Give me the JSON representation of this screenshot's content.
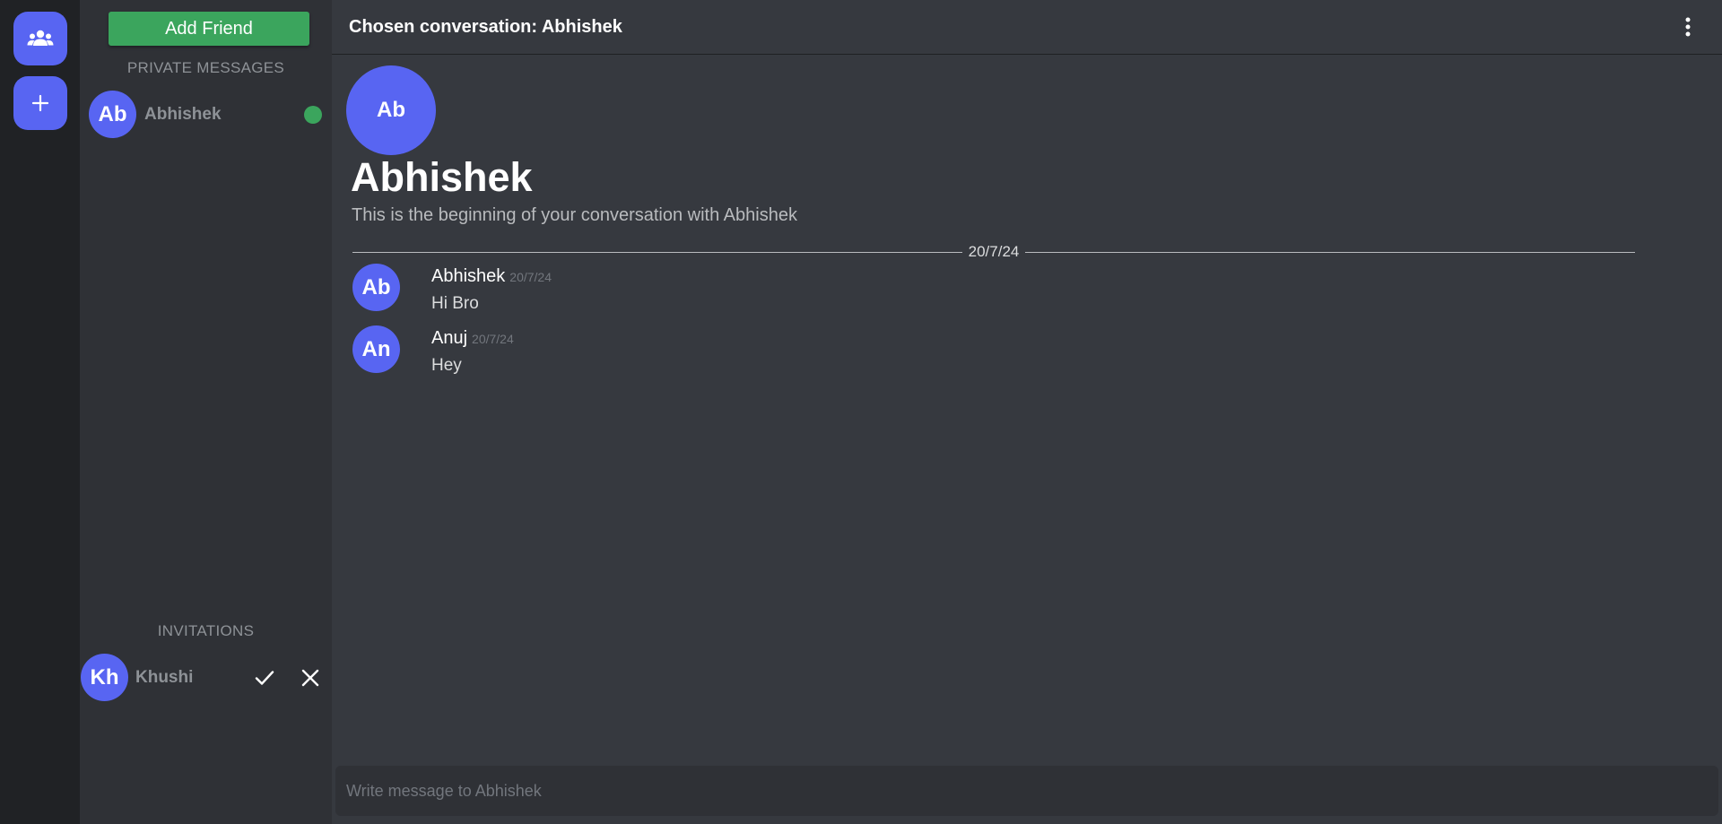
{
  "rail": {
    "friends_icon": "people-icon",
    "add_icon": "plus-icon",
    "accent": "#5865f2"
  },
  "sidebar": {
    "add_friend_label": "Add Friend",
    "private_messages_title": "PRIVATE MESSAGES",
    "private_messages": [
      {
        "initials": "Ab",
        "name": "Abhishek",
        "online": true
      }
    ],
    "invitations_title": "INVITATIONS",
    "invitations": [
      {
        "initials": "Kh",
        "name": "Khushi",
        "accept_icon": "check-icon",
        "reject_icon": "close-icon"
      }
    ]
  },
  "header": {
    "title": "Chosen conversation: Abhishek",
    "menu_icon": "kebab-menu-icon"
  },
  "conversation": {
    "intro_initials": "Ab",
    "intro_name": "Abhishek",
    "intro_text": "This is the beginning of your conversation with Abhishek",
    "date_divider": "20/7/24",
    "messages": [
      {
        "initials": "Ab",
        "author": "Abhishek",
        "time": "20/7/24",
        "text": "Hi Bro"
      },
      {
        "initials": "An",
        "author": "Anuj",
        "time": "20/7/24",
        "text": "Hey"
      }
    ]
  },
  "composer": {
    "placeholder": "Write message to Abhishek"
  },
  "colors": {
    "online": "#3ba55d",
    "add_friend": "#3ba55d",
    "background": "#36393f",
    "sidebar": "#2f3136",
    "rail": "#202225"
  }
}
